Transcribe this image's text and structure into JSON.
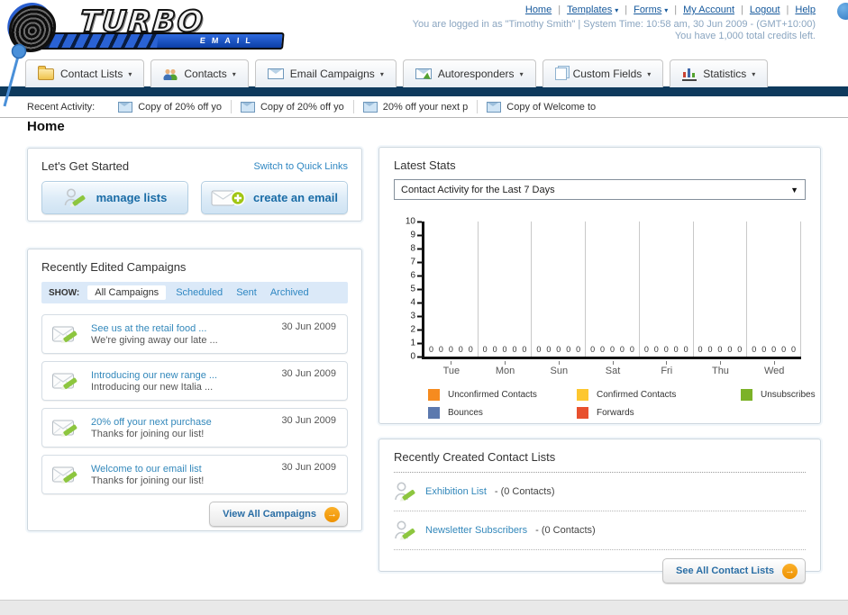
{
  "header": {
    "logo_title": "TURBO",
    "logo_subtitle": "EMAIL",
    "nav": [
      {
        "label": "Home",
        "dropdown": false
      },
      {
        "label": "Templates",
        "dropdown": true
      },
      {
        "label": "Forms",
        "dropdown": true
      },
      {
        "label": "My Account",
        "dropdown": false
      },
      {
        "label": "Logout",
        "dropdown": false
      },
      {
        "label": "Help",
        "dropdown": false
      }
    ],
    "login_line": "You are logged in as \"Timothy Smith\" | System Time: 10:58 am, 30 Jun 2009 - (GMT+10:00)",
    "credits_line": "You have 1,000 total credits left."
  },
  "tabs": [
    {
      "label": "Contact Lists",
      "icon": "folder-icon"
    },
    {
      "label": "Contacts",
      "icon": "contacts-icon"
    },
    {
      "label": "Email Campaigns",
      "icon": "envelope-icon"
    },
    {
      "label": "Autoresponders",
      "icon": "envelope-arrow-icon"
    },
    {
      "label": "Custom Fields",
      "icon": "pages-icon"
    },
    {
      "label": "Statistics",
      "icon": "bar-chart-icon"
    }
  ],
  "recent_activity": {
    "label": "Recent Activity:",
    "items": [
      "Copy of 20% off yo",
      "Copy of 20% off yo",
      "20% off your next p",
      "Copy of Welcome to"
    ]
  },
  "page_title": "Home",
  "get_started": {
    "title": "Let's Get Started",
    "switch_link": "Switch to Quick Links",
    "manage_lists_label": "manage lists",
    "create_email_label": "create an email"
  },
  "campaigns": {
    "title": "Recently Edited Campaigns",
    "show_label": "SHOW:",
    "filters": [
      "All Campaigns",
      "Scheduled",
      "Sent",
      "Archived"
    ],
    "active_filter": "All Campaigns",
    "rows": [
      {
        "title": "See us at the retail food ...",
        "subtitle": "We're giving away our late ...",
        "date": "30 Jun 2009"
      },
      {
        "title": "Introducing our new range ...",
        "subtitle": "Introducing our new Italia ...",
        "date": "30 Jun 2009"
      },
      {
        "title": "20% off your next purchase",
        "subtitle": "Thanks for joining our list!",
        "date": "30 Jun 2009"
      },
      {
        "title": "Welcome to our email list",
        "subtitle": "Thanks for joining our list!",
        "date": "30 Jun 2009"
      }
    ],
    "view_all_label": "View All Campaigns"
  },
  "stats": {
    "title": "Latest Stats",
    "select_value": "Contact Activity for the Last 7 Days"
  },
  "contact_lists": {
    "title": "Recently Created Contact Lists",
    "rows": [
      {
        "name": "Exhibition List",
        "detail": "- (0 Contacts)"
      },
      {
        "name": "Newsletter Subscribers",
        "detail": "- (0 Contacts)"
      }
    ],
    "see_all_label": "See All Contact Lists"
  },
  "chart_data": {
    "type": "bar",
    "title": "Contact Activity for the Last 7 Days",
    "categories": [
      "Tue",
      "Mon",
      "Sun",
      "Sat",
      "Fri",
      "Thu",
      "Wed"
    ],
    "series": [
      {
        "name": "Unconfirmed Contacts",
        "color": "#f68b1f",
        "values": [
          0,
          0,
          0,
          0,
          0,
          0,
          0
        ]
      },
      {
        "name": "Confirmed Contacts",
        "color": "#fdc72f",
        "values": [
          0,
          0,
          0,
          0,
          0,
          0,
          0
        ]
      },
      {
        "name": "Unsubscribes",
        "color": "#7cb228",
        "values": [
          0,
          0,
          0,
          0,
          0,
          0,
          0
        ]
      },
      {
        "name": "Bounces",
        "color": "#5c79ae",
        "values": [
          0,
          0,
          0,
          0,
          0,
          0,
          0
        ]
      },
      {
        "name": "Forwards",
        "color": "#e8502e",
        "values": [
          0,
          0,
          0,
          0,
          0,
          0,
          0
        ]
      }
    ],
    "ylim": [
      0,
      10
    ],
    "yticks": [
      0,
      1,
      2,
      3,
      4,
      5,
      6,
      7,
      8,
      9,
      10
    ],
    "grid": "vertical-day-separators",
    "legend_position": "bottom",
    "bar_label_each": "0"
  },
  "colors": {
    "navy_bar": "#0e3a5d",
    "link_blue": "#3388bb",
    "accent_orange": "#f39c12",
    "filter_bar_bg": "#dbe9f8"
  }
}
